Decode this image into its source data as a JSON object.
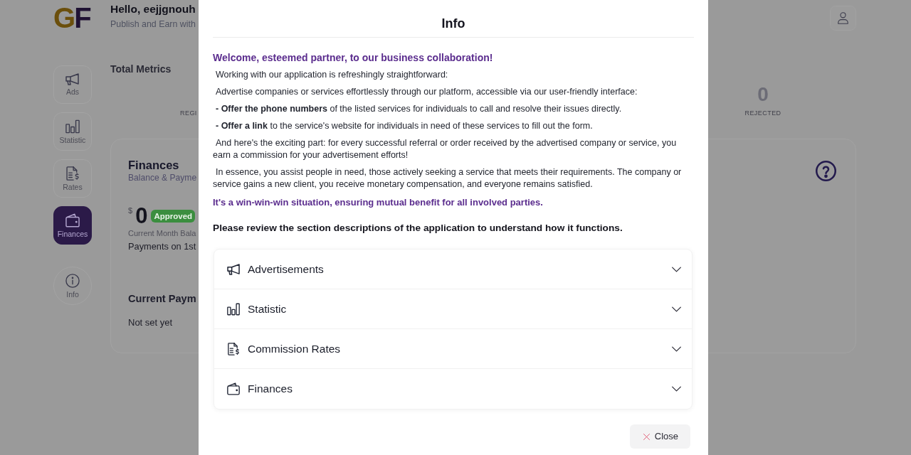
{
  "header": {
    "logo": "GF",
    "greeting": "Hello, eejjgnouh",
    "subtitle": "Publish and Earn with"
  },
  "sidebar": {
    "items": [
      {
        "label": "Ads",
        "kind": "tile",
        "selected": false
      },
      {
        "label": "Statistic",
        "kind": "tile",
        "selected": false
      },
      {
        "label": "Rates",
        "kind": "tile",
        "selected": false
      },
      {
        "label": "Finances",
        "kind": "tile",
        "selected": true
      },
      {
        "label": "Info",
        "kind": "round",
        "selected": false
      }
    ]
  },
  "metrics": {
    "title": "Total Metrics",
    "items": [
      {
        "label": "REGI"
      },
      {
        "value": "0",
        "label": "REJECTED"
      }
    ]
  },
  "finances_card": {
    "title": "Finances",
    "subtitle": "Balance & Payme",
    "balance": {
      "currency": "$",
      "amount": "0",
      "badge": "Approved",
      "caption": "Current Month Bala",
      "note": "Payments on 1st"
    },
    "payment_method": {
      "title": "Current Paym",
      "value": "Not set yet"
    }
  },
  "modal": {
    "title": "Info",
    "heading": "Welcome, esteemed partner, to our business collaboration!",
    "paragraphs": [
      "Working with our application is refreshingly straightforward:",
      "Advertise companies or services effortlessly through our platform, accessible via our user-friendly interface:",
      "**- Offer the phone numbers** of the listed services for individuals to call and resolve their issues directly.",
      "**- Offer a link** to the service's website for individuals in need of these services to fill out the form.",
      "And here's the exciting part: for every successful referral or order received by the advertised company or service, you earn a commission for your advertisement efforts!",
      "In essence, you assist people in need, those actively seeking a service that meets their requirements. The company or service gains a new client, you receive monetary compensation, and everyone remains satisfied."
    ],
    "closing": "It's a win-win-win situation, ensuring mutual benefit for all involved parties.",
    "instruction": "Please review the section descriptions of the application to understand how it functions.",
    "sections": [
      {
        "label": "Advertisements",
        "expanded": false
      },
      {
        "label": "Statistic",
        "expanded": false
      },
      {
        "label": "Commission Rates",
        "expanded": false
      },
      {
        "label": "Finances",
        "expanded": false
      }
    ],
    "close_button": "Close"
  }
}
